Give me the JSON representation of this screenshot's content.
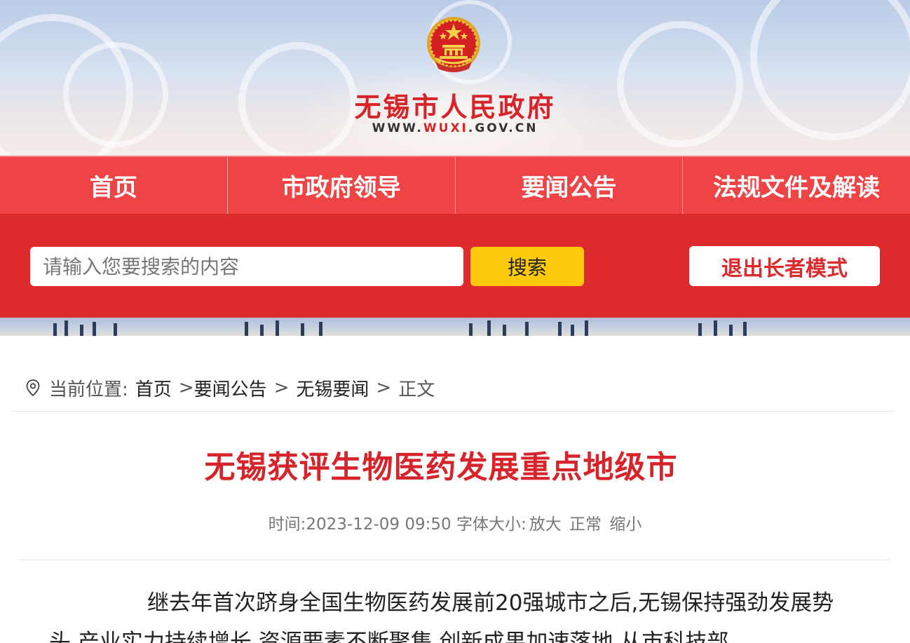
{
  "header": {
    "site_title": "无锡市人民政府",
    "site_url_prefix": "WWW.",
    "site_url_highlight": "WUXI",
    "site_url_suffix": ".GOV.CN"
  },
  "nav": {
    "items": [
      {
        "label": "首页"
      },
      {
        "label": "市政府领导"
      },
      {
        "label": "要闻公告"
      },
      {
        "label": "法规文件及解读"
      }
    ]
  },
  "search": {
    "placeholder": "请输入您要搜索的内容",
    "button_label": "搜索",
    "exit_elder_mode_label": "退出长者模式"
  },
  "breadcrumb": {
    "label": "当前位置:",
    "items": [
      "首页",
      "要闻公告",
      "无锡要闻",
      "正文"
    ],
    "separator": ">"
  },
  "article": {
    "title": "无锡获评生物医药发展重点地级市",
    "time_label": "时间:",
    "time_value": "2023-12-09 09:50",
    "font_size_label": "字体大小:",
    "font_options": [
      "放大",
      "正常",
      "缩小"
    ],
    "body": "继去年首次跻身全国生物医药发展前20强城市之后,无锡保持强劲发展势头,产业实力持续增长,资源要素不断聚集,创新成果加速落地,从市科技部"
  },
  "colors": {
    "brand_red": "#d7232a",
    "nav_red": "#ef4446",
    "search_band_red": "#dd2a2c",
    "search_button_yellow": "#fdca0b"
  },
  "icons": {
    "emblem": "national-emblem-icon",
    "location": "location-pin-icon"
  }
}
